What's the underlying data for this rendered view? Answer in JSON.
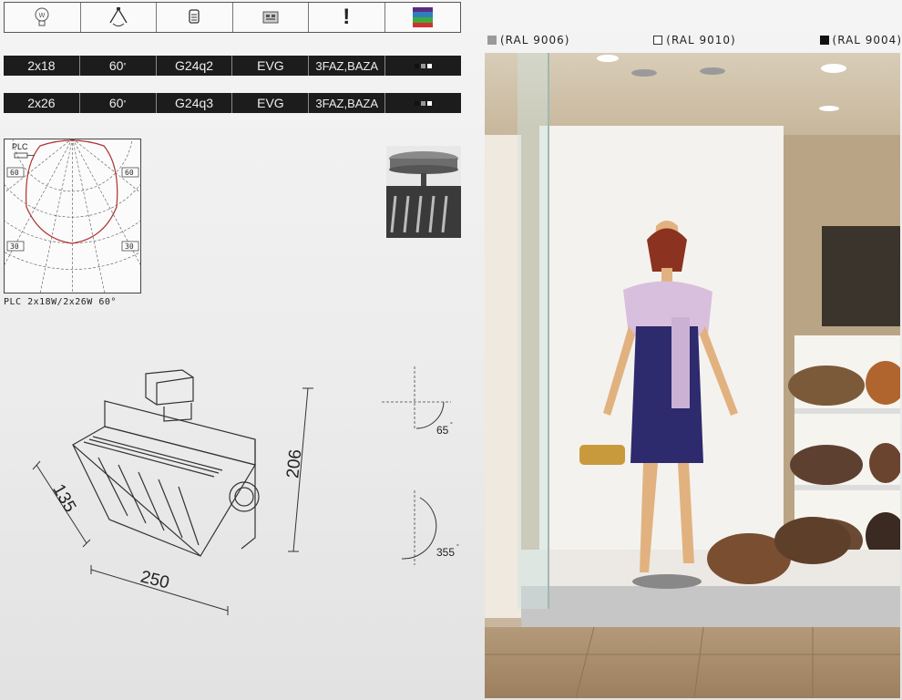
{
  "icons": [
    {
      "name": "bulb-icon"
    },
    {
      "name": "beam-angle-icon"
    },
    {
      "name": "socket-icon"
    },
    {
      "name": "ballast-icon"
    },
    {
      "name": "warning-icon",
      "symbol": "!"
    },
    {
      "name": "color-swatch-icon"
    }
  ],
  "specs": [
    {
      "power": "2x18",
      "angle": "60",
      "socket": "G24q2",
      "gear": "EVG",
      "mount": "3FAZ,BAZA"
    },
    {
      "power": "2x26",
      "angle": "60",
      "socket": "G24q3",
      "gear": "EVG",
      "mount": "3FAZ,BAZA"
    }
  ],
  "polar": {
    "lamp_label": "PLC",
    "angle_60": "60",
    "angle_30": "30",
    "caption": "PLC 2x18W/2x26W 60°"
  },
  "dimensions": {
    "depth": "135",
    "width": "250",
    "height": "206",
    "tilt": "65",
    "rotation": "355"
  },
  "finishes": [
    {
      "label": "(RAL 9006)",
      "color": "#9a9a9a"
    },
    {
      "label": "(RAL 9010)",
      "color": "#ffffff"
    },
    {
      "label": "(RAL 9004)",
      "color": "#111111"
    }
  ]
}
